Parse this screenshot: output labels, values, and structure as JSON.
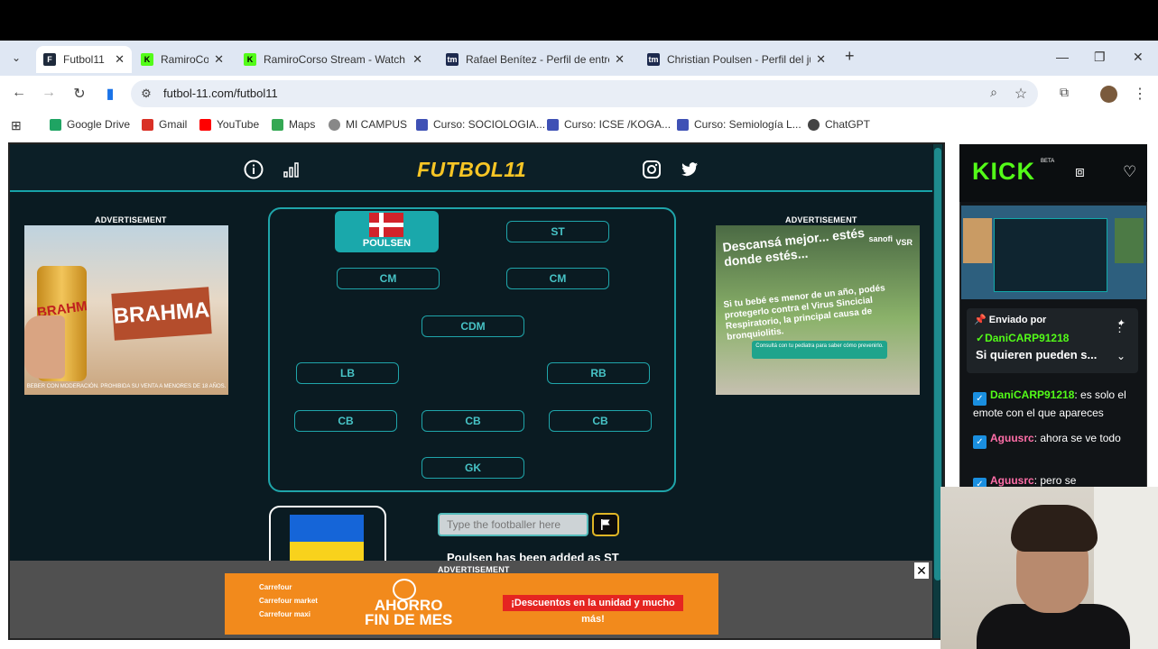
{
  "browser": {
    "tabs": [
      {
        "title": "Futbol11",
        "favicon_color": "#1e2a3c",
        "favicon_glyph": "F",
        "active": true
      },
      {
        "title": "RamiroCo",
        "favicon_color": "#53fc18",
        "favicon_glyph": "K",
        "active": false
      },
      {
        "title": "RamiroCorso Stream - Watch L",
        "favicon_color": "#53fc18",
        "favicon_glyph": "K",
        "active": false
      },
      {
        "title": "Rafael Benítez - Perfil de entre",
        "favicon_color": "#1d2a4e",
        "favicon_glyph": "tm",
        "active": false
      },
      {
        "title": "Christian Poulsen - Perfil del jug",
        "favicon_color": "#1d2a4e",
        "favicon_glyph": "tm",
        "active": false
      }
    ],
    "new_tab_label": "+",
    "url": "futbol-11.com/futbol11",
    "bookmarks": [
      {
        "label": "Google Drive",
        "color": "#1fa463"
      },
      {
        "label": "Gmail",
        "color": "#d93025"
      },
      {
        "label": "YouTube",
        "color": "#ff0000"
      },
      {
        "label": "Maps",
        "color": "#34a853"
      },
      {
        "label": "MI CAMPUS",
        "color": "#888888"
      },
      {
        "label": "Curso: SOCIOLOGIA...",
        "color": "#3f51b5"
      },
      {
        "label": "Curso: ICSE /KOGA...",
        "color": "#3f51b5"
      },
      {
        "label": "Curso: Semiología L...",
        "color": "#3f51b5"
      },
      {
        "label": "ChatGPT",
        "color": "#444444"
      }
    ]
  },
  "game": {
    "logo": "FUTBOL11",
    "ad_label": "ADVERTISEMENT",
    "ad_left": {
      "brand": "BRAHMA",
      "can_text": "BRAHM",
      "fine_print": "BEBER CON MODERACIÓN. PROHIBIDA SU VENTA A MENORES DE 18 AÑOS."
    },
    "ad_right": {
      "headline": "Descansá mejor... estés donde estés...",
      "brand": "sanofi",
      "vsr": "VSR",
      "body": "Si tu bebé es menor de un año, podés protegerlo contra el Virus Sincicial Respiratorio, la principal causa de bronquiolitis.",
      "cta": "Consultá con tu pediatra para saber cómo prevenirlo."
    },
    "filled_position": {
      "name": "POULSEN",
      "role": "ST"
    },
    "positions": [
      "ST",
      "CM",
      "CM",
      "CDM",
      "LB",
      "RB",
      "CB",
      "CB",
      "CB",
      "GK"
    ],
    "search_placeholder": "Type the footballer here",
    "message": "Poulsen has been added as ST",
    "bottom_ad": {
      "brands": [
        "Carrefour",
        "Carrefour",
        "Carrefour"
      ],
      "brand_subs": [
        "",
        "market",
        "maxi"
      ],
      "title_line1": "AHORRO",
      "title_line2": "FIN DE MES",
      "promo": "¡Descuentos en la unidad y mucho más!"
    }
  },
  "kick": {
    "logo": "KICK",
    "beta": "BETA",
    "pinned_by_label": "Enviado por",
    "pinned_user": "DaniCARP91218",
    "pinned_text": "Si quieren pueden s...",
    "messages": [
      {
        "user": "DaniCARP91218",
        "user_color": "#53fc18",
        "text": ": es solo el emote con el que apareces"
      },
      {
        "user": "Aguusrc",
        "user_color": "#ff6ea8",
        "text": ": ahora se ve todo"
      },
      {
        "user": "Aguusrc",
        "user_color": "#ff6ea8",
        "text": ": pero se"
      }
    ]
  }
}
